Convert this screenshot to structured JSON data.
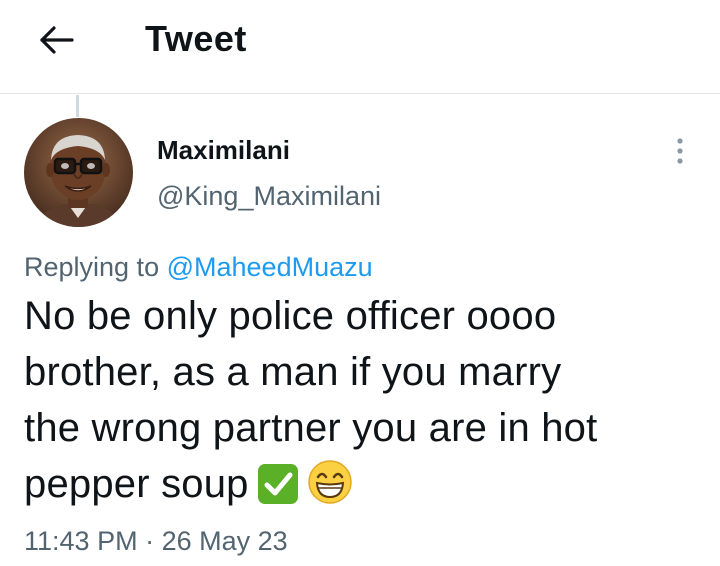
{
  "header": {
    "back_icon": "arrow-left-icon",
    "title": "Tweet"
  },
  "tweet": {
    "author": {
      "name": "Maximilani",
      "handle": "@King_Maximilani",
      "avatar": "profile-photo"
    },
    "more_icon": "more-vertical-icon",
    "replying_to_label": "Replying to",
    "replying_to_handle": "@MaheedMuazu",
    "text_lines": [
      "No be only police officer oooo",
      "brother, as a man if you marry",
      "the wrong partner you are in hot",
      "pepper soup"
    ],
    "emojis": [
      "check-mark-button-emoji",
      "grinning-face-emoji"
    ],
    "time": "11:43 PM",
    "separator": "·",
    "date": "26 May 23"
  },
  "colors": {
    "text": "#0f1419",
    "secondary": "#536471",
    "link": "#1d9bf0",
    "divider": "#e3e6e8",
    "check_green": "#5ab026"
  }
}
